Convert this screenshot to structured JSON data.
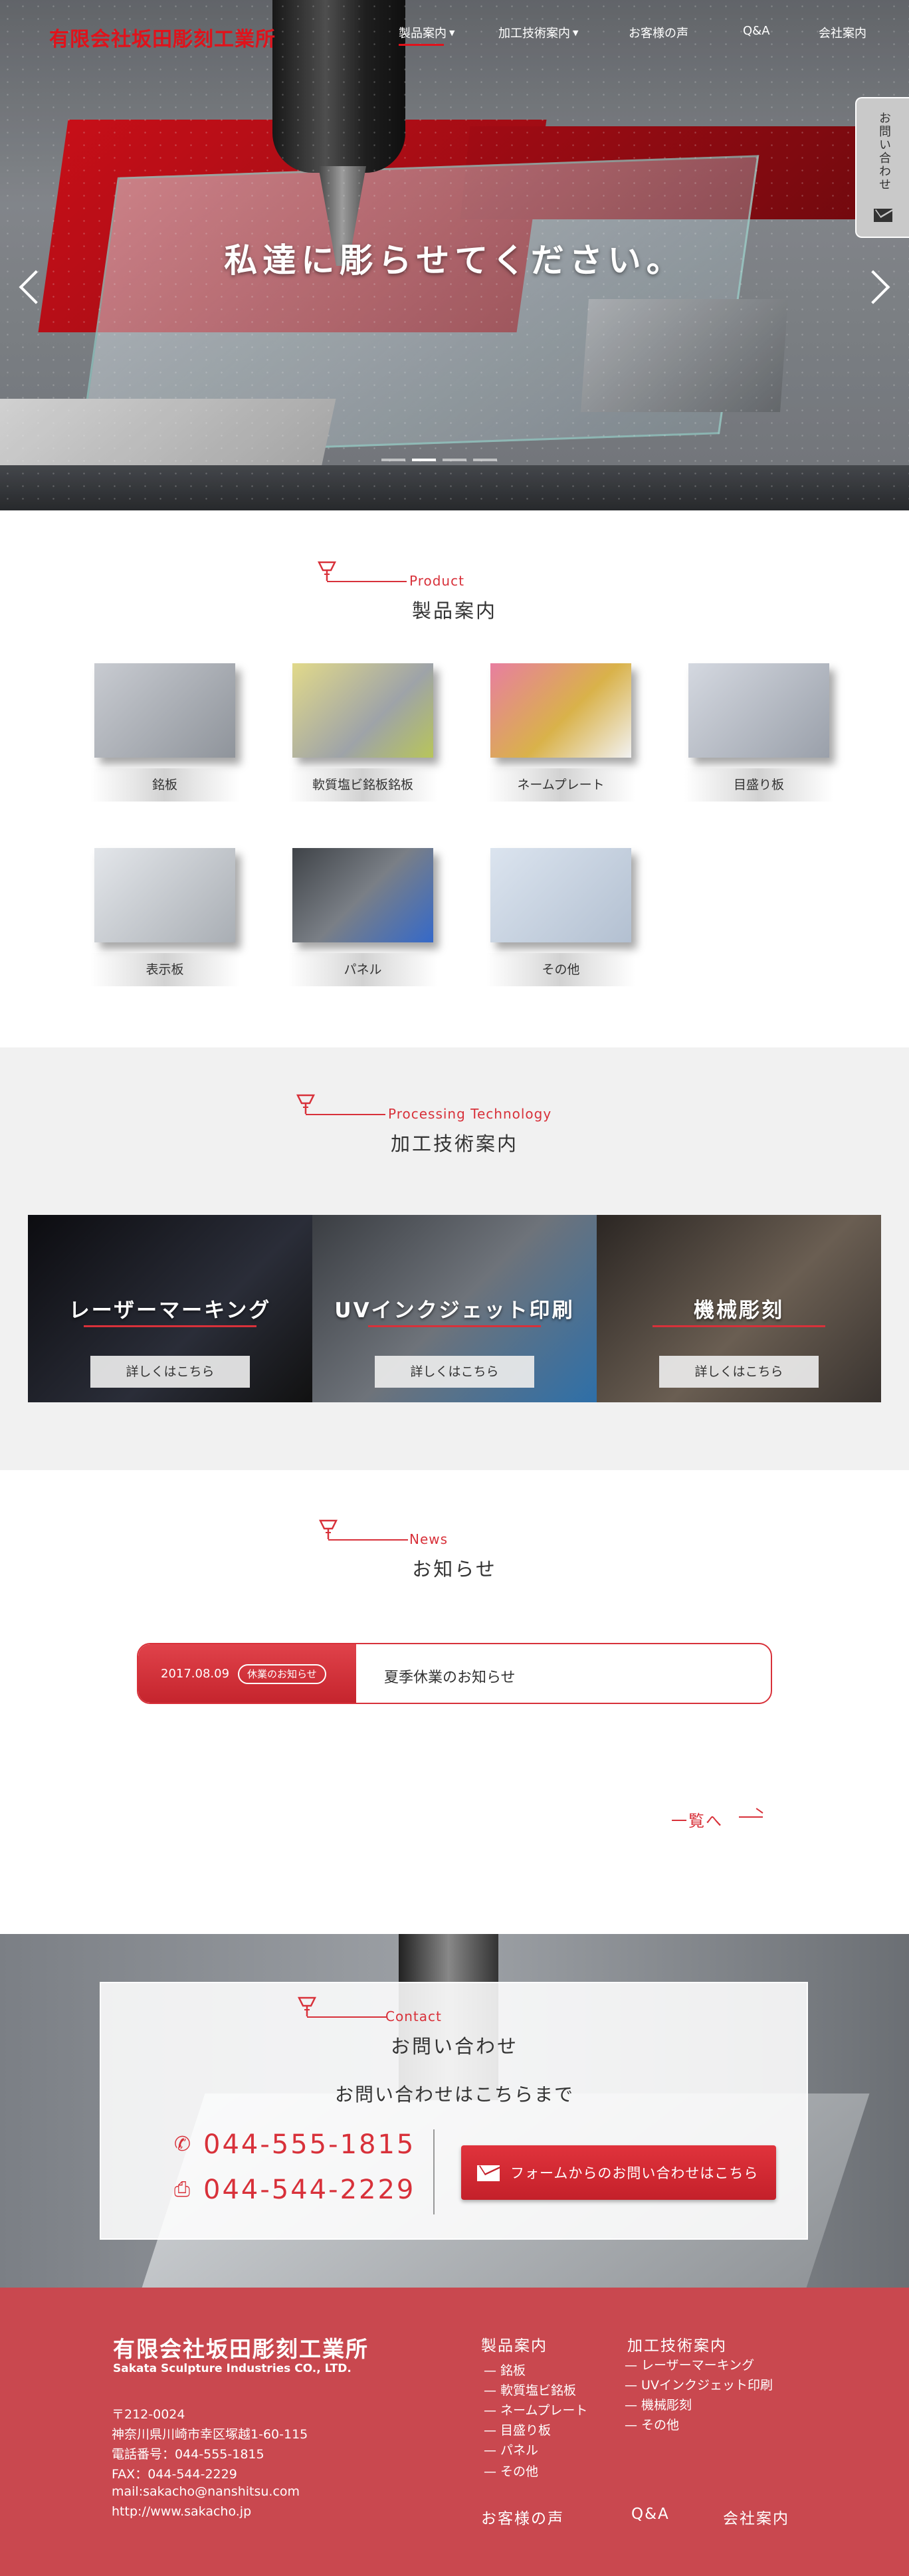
{
  "header": {
    "logo": "有限会社坂田彫刻工業所",
    "nav": [
      {
        "label": "製品案内",
        "dropdown": true
      },
      {
        "label": "加工技術案内",
        "dropdown": true
      },
      {
        "label": "お客様の声",
        "dropdown": false
      },
      {
        "label": "Q&A",
        "dropdown": false
      },
      {
        "label": "会社案内",
        "dropdown": false
      }
    ],
    "side_tab": "お問い合わせ"
  },
  "hero": {
    "catch": "私達に彫らせてください。",
    "slides": 4,
    "active_slide": 1
  },
  "products": {
    "en": "Product",
    "title": "製品案内",
    "items": [
      {
        "label": "銘板",
        "color": "#b9bcc3"
      },
      {
        "label": "軟質塩ビ銘板銘板",
        "color": "#c7c66e"
      },
      {
        "label": "ネームプレート",
        "color": "#c96f8c"
      },
      {
        "label": "目盛り板",
        "color": "#b7bcc6"
      },
      {
        "label": "表示板",
        "color": "#d6d9df"
      },
      {
        "label": "パネル",
        "color": "#55595f"
      },
      {
        "label": "その他",
        "color": "#c9d4e1"
      }
    ]
  },
  "processing": {
    "en": "Processing Technology",
    "title": "加工技術案内",
    "items": [
      {
        "title": "レーザーマーキング",
        "button": "詳しくはこちら"
      },
      {
        "title": "UVインクジェット印刷",
        "button": "詳しくはこちら"
      },
      {
        "title": "機械彫刻",
        "button": "詳しくはこちら"
      }
    ]
  },
  "news": {
    "en": "News",
    "title": "お知らせ",
    "items": [
      {
        "date": "2017.08.09",
        "category": "休業のお知らせ",
        "title": "夏季休業のお知らせ"
      }
    ],
    "more": "一覧へ"
  },
  "contact": {
    "en": "Contact",
    "title": "お問い合わせ",
    "lead": "お問い合わせはこちらまで",
    "tel": "044-555-1815",
    "fax": "044-544-2229",
    "form_button": "フォームからのお問い合わせはこちら"
  },
  "footer": {
    "company": "有限会社坂田彫刻工業所",
    "company_en": "Sakata Sculpture Industries CO., LTD.",
    "address_lines": [
      "〒212-0024",
      "神奈川県川崎市幸区塚越1-60-115",
      "電話番号：044-555-1815",
      "FAX：044-544-2229",
      "mail:sakacho@nanshitsu.com",
      "http://www.sakacho.jp"
    ],
    "col1_title": "製品案内",
    "col1_links": [
      "銘板",
      "軟質塩ビ銘板",
      "ネームプレート",
      "目盛り板",
      "パネル",
      "その他"
    ],
    "col2_title": "加工技術案内",
    "col2_links": [
      "レーザーマーキング",
      "UVインクジェット印刷",
      "機械彫刻",
      "その他"
    ],
    "bottom_links": [
      "お客様の声",
      "Q&A",
      "会社案内"
    ]
  }
}
